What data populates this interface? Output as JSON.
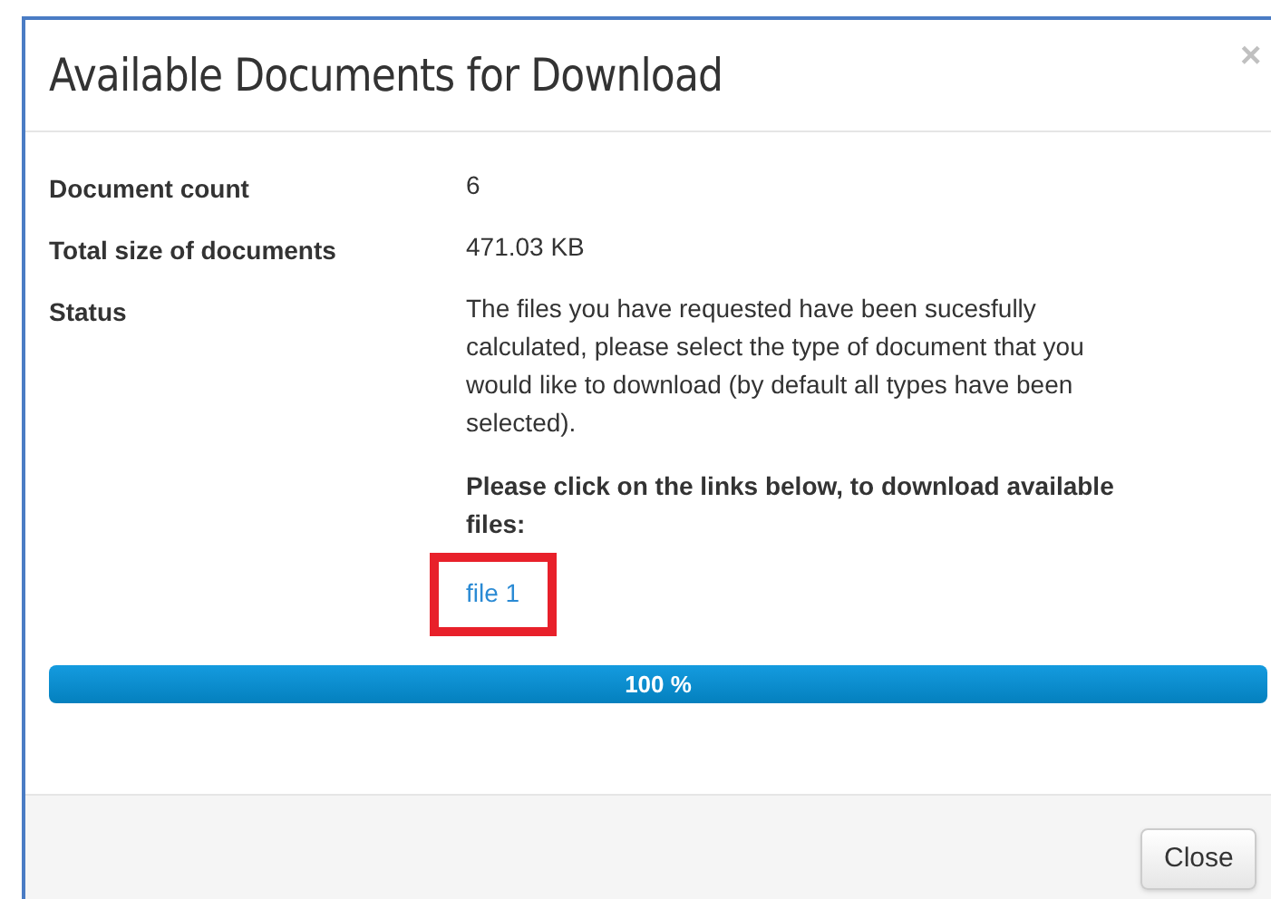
{
  "dialog": {
    "title": "Available Documents for Download",
    "close_icon": "×"
  },
  "details": [
    {
      "label": "Document count",
      "value": "6"
    },
    {
      "label": "Total size of documents",
      "value": "471.03 KB"
    },
    {
      "label": "Status",
      "value": "The files you have requested have been sucesfully calculated, please select the type of document that you would like to download (by default all types have been selected)."
    }
  ],
  "instruction": "Please click on the links below, to download available files:",
  "links": [
    {
      "label": "file 1",
      "highlighted": true
    }
  ],
  "progress": {
    "level": 1,
    "label": "100 %"
  },
  "buttons": [
    "Close"
  ]
}
